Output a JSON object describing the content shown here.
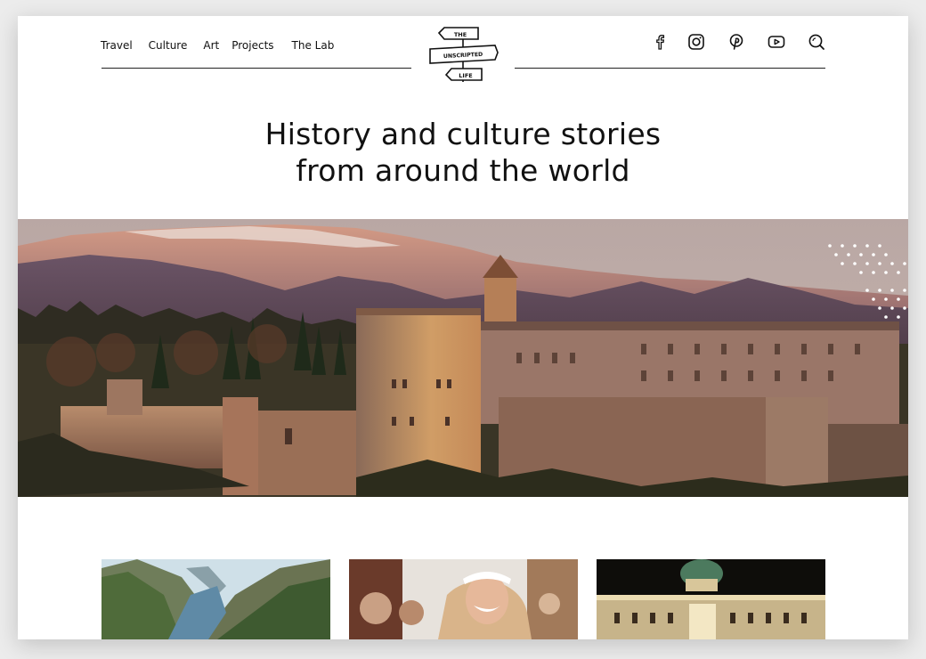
{
  "nav": {
    "items": [
      "Travel",
      "Culture",
      "Art",
      "Projects",
      "The Lab"
    ]
  },
  "logo": {
    "line1": "THE",
    "line2": "UNSCRIPTED",
    "line3": "LIFE"
  },
  "social_icons": [
    "facebook-icon",
    "instagram-icon",
    "pinterest-icon",
    "youtube-icon",
    "search-icon"
  ],
  "headline": {
    "line1": "History and culture stories",
    "line2": "from around the world"
  },
  "hero": {
    "subject": "alhambra-palace"
  },
  "cards": [
    {
      "image": "fjord-landscape"
    },
    {
      "image": "smiling-woman-festival"
    },
    {
      "image": "palace-at-night"
    }
  ],
  "colors": {
    "text": "#111111",
    "background": "#ffffff",
    "page_bg": "#ececec"
  }
}
